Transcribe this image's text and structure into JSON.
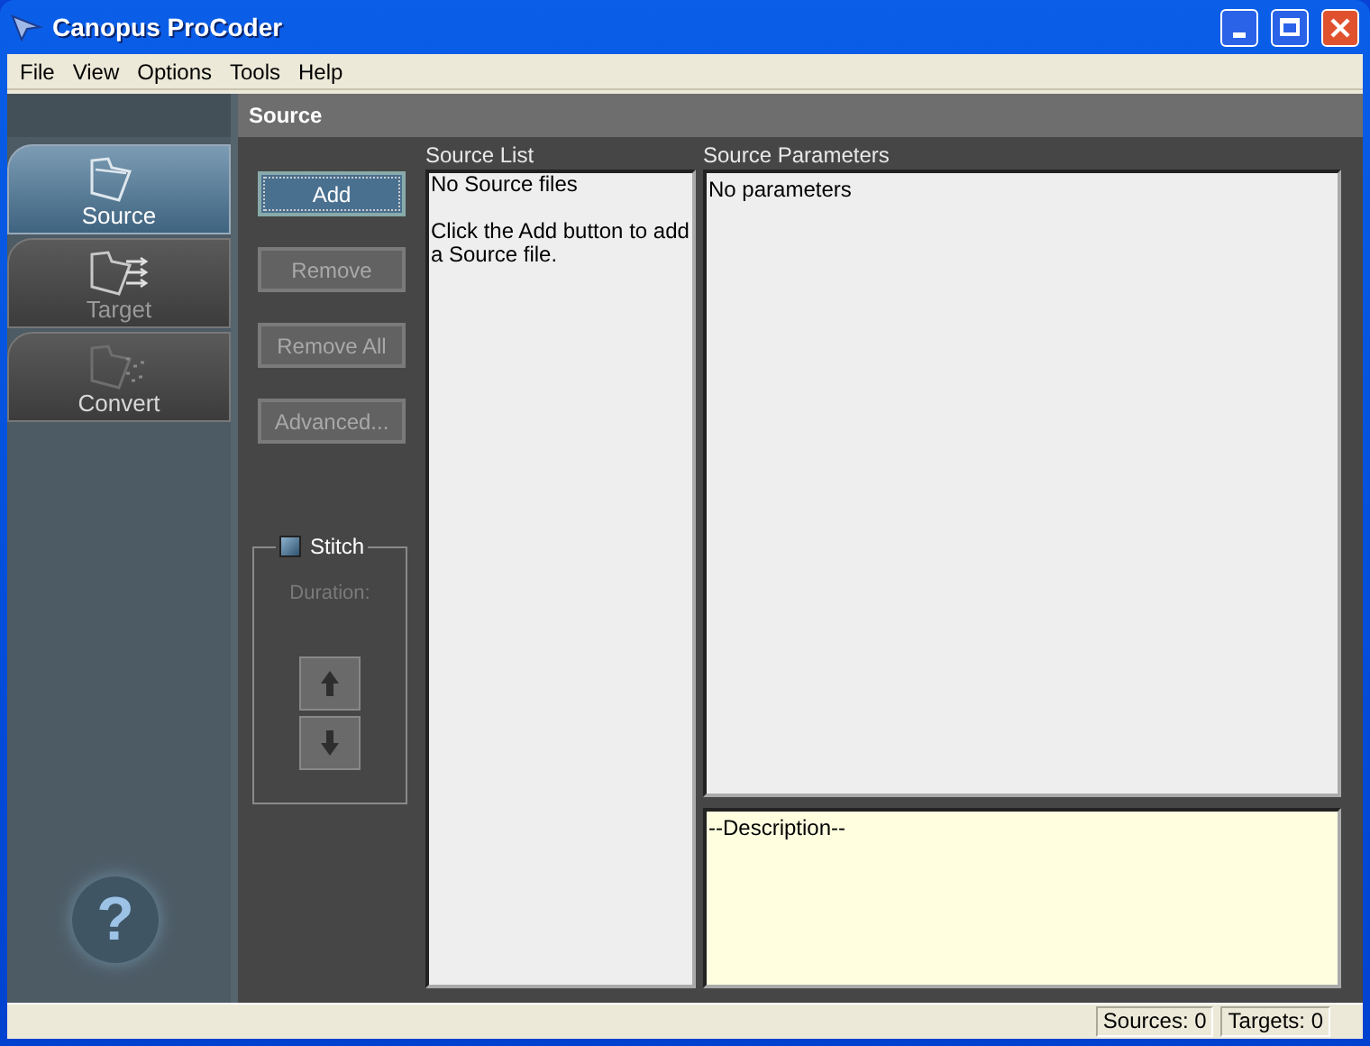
{
  "window": {
    "title": "Canopus ProCoder"
  },
  "menu": [
    "File",
    "View",
    "Options",
    "Tools",
    "Help"
  ],
  "nav": [
    {
      "label": "Source",
      "kind": "source",
      "selected": true
    },
    {
      "label": "Target",
      "kind": "target",
      "selected": false
    },
    {
      "label": "Convert",
      "kind": "convert",
      "selected": false
    }
  ],
  "panel_title": "Source",
  "help_button": "?",
  "buttons": [
    {
      "label": "Add",
      "disabled": false
    },
    {
      "label": "Remove",
      "disabled": true
    },
    {
      "label": "Remove All",
      "disabled": true
    },
    {
      "label": "Advanced...",
      "disabled": true
    }
  ],
  "stitch": {
    "label": "Stitch",
    "checked": false,
    "duration_label": "Duration:",
    "disabled": true
  },
  "source_list": {
    "label": "Source List",
    "lines": [
      "No Source files",
      "Click the Add button to add a Source file."
    ]
  },
  "source_parameters": {
    "label": "Source Parameters",
    "text": "No parameters"
  },
  "description": "--Description--",
  "status_bar": [
    "Sources: 0",
    "Targets: 0"
  ]
}
